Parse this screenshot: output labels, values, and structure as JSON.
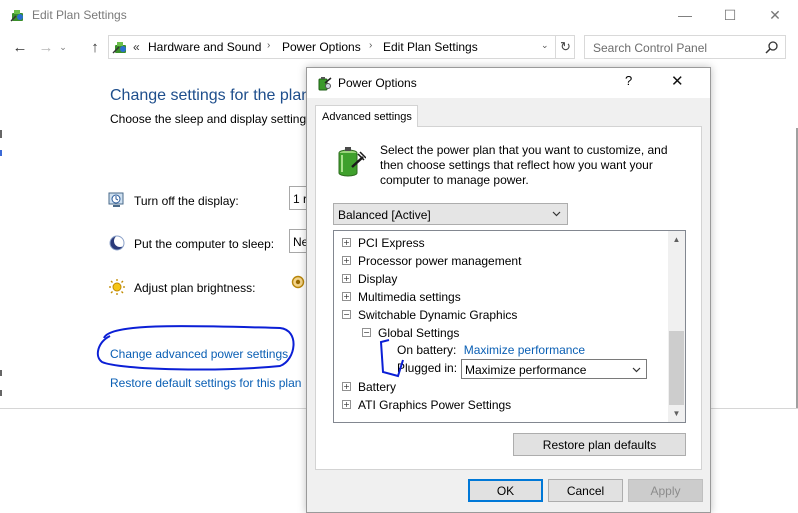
{
  "window": {
    "title": "Edit Plan Settings",
    "caption": {
      "minimize": "—",
      "maximize": "☐",
      "close": "✕"
    }
  },
  "navigation": {
    "back": "←",
    "forward": "→",
    "recent": "⌄",
    "up": "↑",
    "address_prefix": "«",
    "breadcrumbs": [
      "Hardware and Sound",
      "Power Options",
      "Edit Plan Settings"
    ],
    "breadcrumb_separator": "›",
    "address_dropdown": "⌄",
    "refresh": "↻",
    "search_placeholder": "Search Control Panel"
  },
  "control_panel": {
    "heading": "Change settings for the plan:",
    "subtitle": "Choose the sleep and display settings",
    "settings": [
      {
        "label": "Turn off the display:",
        "icon": "monitor-clock-icon",
        "value": "1 r"
      },
      {
        "label": "Put the computer to sleep:",
        "icon": "moon-sleep-icon",
        "value": "Ne"
      },
      {
        "label": "Adjust plan brightness:",
        "icon": "sun-brightness-icon",
        "value": ""
      }
    ],
    "links": {
      "advanced": "Change advanced power settings",
      "restore": "Restore default settings for this plan"
    }
  },
  "dialog": {
    "title": "Power Options",
    "help": "?",
    "close": "✕",
    "tab": "Advanced settings",
    "intro": "Select the power plan that you want to customize, and then choose settings that reflect how you want your computer to manage power.",
    "plan_selected": "Balanced [Active]",
    "tree": [
      {
        "label": "PCI Express",
        "expander": "+"
      },
      {
        "label": "Processor power management",
        "expander": "+"
      },
      {
        "label": "Display",
        "expander": "+"
      },
      {
        "label": "Multimedia settings",
        "expander": "+"
      },
      {
        "label": "Switchable Dynamic Graphics",
        "expander": "−"
      },
      {
        "label": "Global Settings",
        "expander": "−"
      },
      {
        "label": "On battery:",
        "value": "Maximize performance"
      },
      {
        "label": "Plugged in:",
        "value": "Maximize performance"
      },
      {
        "label": "Battery",
        "expander": "+"
      },
      {
        "label": "ATI Graphics Power Settings",
        "expander": "+"
      }
    ],
    "scroll_up": "▲",
    "scroll_down": "▼",
    "buttons": {
      "restore": "Restore plan defaults",
      "ok": "OK",
      "cancel": "Cancel",
      "apply": "Apply"
    }
  },
  "colors": {
    "heading_blue": "#1e4e8c",
    "link_blue": "#0a5fb4",
    "annotation_blue": "#0b1fd6",
    "focus_blue": "#0078d7"
  }
}
